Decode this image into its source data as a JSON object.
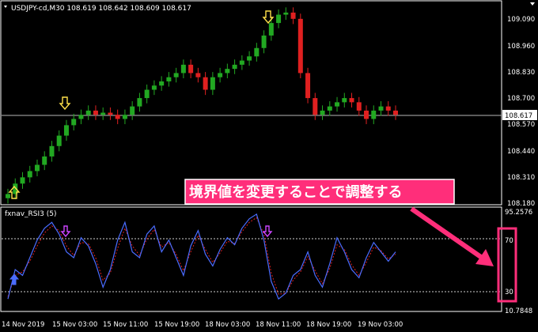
{
  "window": {
    "symbol_header": "USDJPY-cd,M30 108.619 108.642 108.609 108.617"
  },
  "price_axis": {
    "labels": [
      "109.090",
      "108.960",
      "108.830",
      "108.700",
      "108.570",
      "108.440",
      "108.310",
      "108.180"
    ],
    "current_price": "108.617"
  },
  "indicator": {
    "title": "fxnav_RSI3 (5)",
    "top_value": "95.2576",
    "bottom_value": "10.7848",
    "level_high": "70",
    "level_low": "30"
  },
  "time_axis": {
    "labels": [
      "14 Nov 2019",
      "15 Nov 03:00",
      "15 Nov 11:00",
      "15 Nov 19:00",
      "18 Nov 03:00",
      "18 Nov 11:00",
      "18 Nov 19:00",
      "19 Nov 03:00"
    ]
  },
  "annotation": {
    "text": "境界値を変更することで調整する"
  },
  "colors": {
    "background": "#000000",
    "bull_candle": "#22a822",
    "bear_candle": "#e02020",
    "rsi_line": "#4a6cff",
    "signal_line": "#e02020",
    "annotation_pink": "#ff2e7a",
    "arrow_yellow": "#ffe14a",
    "arrow_magenta": "#cc44ff"
  },
  "chart_data": [
    {
      "type": "line",
      "title": "USDJPY-cd,M30",
      "ylim": [
        108.18,
        109.12
      ],
      "series": [
        {
          "name": "price",
          "values": [
            108.22,
            108.27,
            108.3,
            108.33,
            108.36,
            108.4,
            108.45,
            108.5,
            108.55,
            108.58,
            108.6,
            108.62,
            108.6,
            108.61,
            108.6,
            108.58,
            108.6,
            108.64,
            108.68,
            108.72,
            108.74,
            108.76,
            108.78,
            108.8,
            108.84,
            108.8,
            108.78,
            108.72,
            108.78,
            108.8,
            108.82,
            108.84,
            108.86,
            108.88,
            108.92,
            108.98,
            109.04,
            109.08,
            109.09,
            109.06,
            108.8,
            108.68,
            108.6,
            108.62,
            108.64,
            108.66,
            108.68,
            108.66,
            108.62,
            108.58,
            108.62,
            108.64,
            108.62,
            108.6
          ]
        }
      ]
    },
    {
      "type": "line",
      "title": "fxnav_RSI3 (5)",
      "ylim": [
        10.78,
        95.26
      ],
      "series": [
        {
          "name": "rsi",
          "values": [
            20,
            45,
            40,
            55,
            70,
            80,
            85,
            75,
            60,
            55,
            72,
            65,
            50,
            30,
            45,
            70,
            85,
            60,
            55,
            75,
            82,
            60,
            70,
            55,
            40,
            65,
            78,
            58,
            48,
            62,
            72,
            66,
            80,
            88,
            92,
            70,
            35,
            20,
            25,
            40,
            45,
            60,
            40,
            30,
            50,
            72,
            60,
            45,
            38,
            55,
            68,
            60,
            52,
            60
          ]
        },
        {
          "name": "signal",
          "values": [
            22,
            40,
            43,
            52,
            65,
            76,
            82,
            78,
            65,
            57,
            68,
            67,
            55,
            36,
            42,
            63,
            80,
            65,
            57,
            71,
            79,
            64,
            68,
            58,
            44,
            60,
            74,
            62,
            51,
            59,
            69,
            67,
            77,
            85,
            89,
            75,
            42,
            24,
            25,
            36,
            43,
            56,
            44,
            33,
            46,
            66,
            62,
            49,
            40,
            51,
            64,
            61,
            54,
            58
          ]
        }
      ]
    }
  ]
}
